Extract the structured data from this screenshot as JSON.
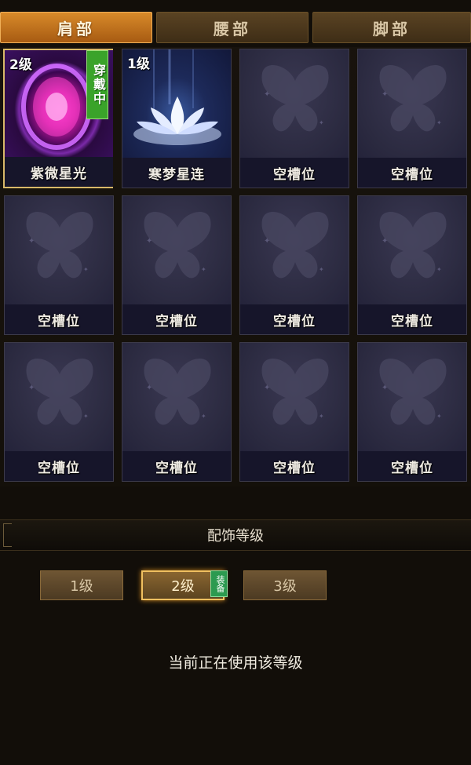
{
  "tabs": [
    {
      "label": "肩部",
      "active": true
    },
    {
      "label": "腰部",
      "active": false
    },
    {
      "label": "脚部",
      "active": false
    }
  ],
  "slots": [
    {
      "name": "紫微星光",
      "level": "2级",
      "wear_badge": "穿戴中",
      "icon": "purple-orb-icon",
      "selected": true
    },
    {
      "name": "寒梦星连",
      "level": "1级",
      "icon": "white-lotus-icon"
    },
    {
      "name": "空槽位",
      "icon": "butterfly-placeholder-icon"
    },
    {
      "name": "空槽位",
      "icon": "butterfly-placeholder-icon"
    },
    {
      "name": "空槽位",
      "icon": "butterfly-placeholder-icon"
    },
    {
      "name": "空槽位",
      "icon": "butterfly-placeholder-icon"
    },
    {
      "name": "空槽位",
      "icon": "butterfly-placeholder-icon"
    },
    {
      "name": "空槽位",
      "icon": "butterfly-placeholder-icon"
    },
    {
      "name": "空槽位",
      "icon": "butterfly-placeholder-icon"
    },
    {
      "name": "空槽位",
      "icon": "butterfly-placeholder-icon"
    },
    {
      "name": "空槽位",
      "icon": "butterfly-placeholder-icon"
    },
    {
      "name": "空槽位",
      "icon": "butterfly-placeholder-icon"
    }
  ],
  "panel": {
    "title": "配饰等级",
    "levels": [
      {
        "label": "1级",
        "active": false
      },
      {
        "label": "2级",
        "active": true
      },
      {
        "label": "3级",
        "active": false
      }
    ],
    "equip_badge": "装备",
    "status_text": "当前正在使用该等级"
  },
  "colors": {
    "tab_active": "#c9791f",
    "slot_bg": "#2b2a40",
    "wear_badge": "#3aa32a"
  }
}
